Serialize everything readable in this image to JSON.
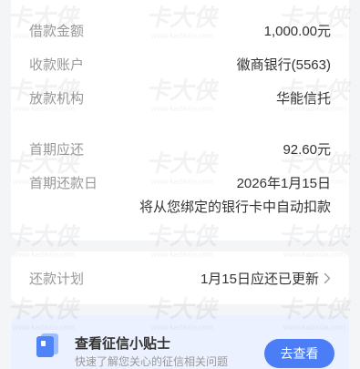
{
  "colors": {
    "background": "#f4f5f7",
    "card": "#ffffff",
    "label": "#999999",
    "value": "#333333",
    "accent": "#4b7ef6",
    "tips_background": "#ebf1fe"
  },
  "loan_info": {
    "rows": [
      {
        "label": "借款金额",
        "value": "1,000.00元"
      },
      {
        "label": "收款账户",
        "value": "徽商银行(5563)"
      },
      {
        "label": "放款机构",
        "value": "华能信托"
      }
    ]
  },
  "first_installment": {
    "rows": [
      {
        "label": "首期应还",
        "value": "92.60元"
      },
      {
        "label": "首期还款日",
        "value": "2026年1月15日"
      }
    ],
    "note": "将从您绑定的银行卡中自动扣款"
  },
  "repayment_plan": {
    "label": "还款计划",
    "status": "1月15日应还已更新",
    "icon": "chevron-right-icon"
  },
  "credit_tips": {
    "icon": "credit-report-icon",
    "title": "查看征信小贴士",
    "subtitle": "快速了解您关心的征信相关问题",
    "button_label": "去查看"
  },
  "watermark": {
    "brand": "卡大侠",
    "site": "www.kadaxia.com"
  }
}
